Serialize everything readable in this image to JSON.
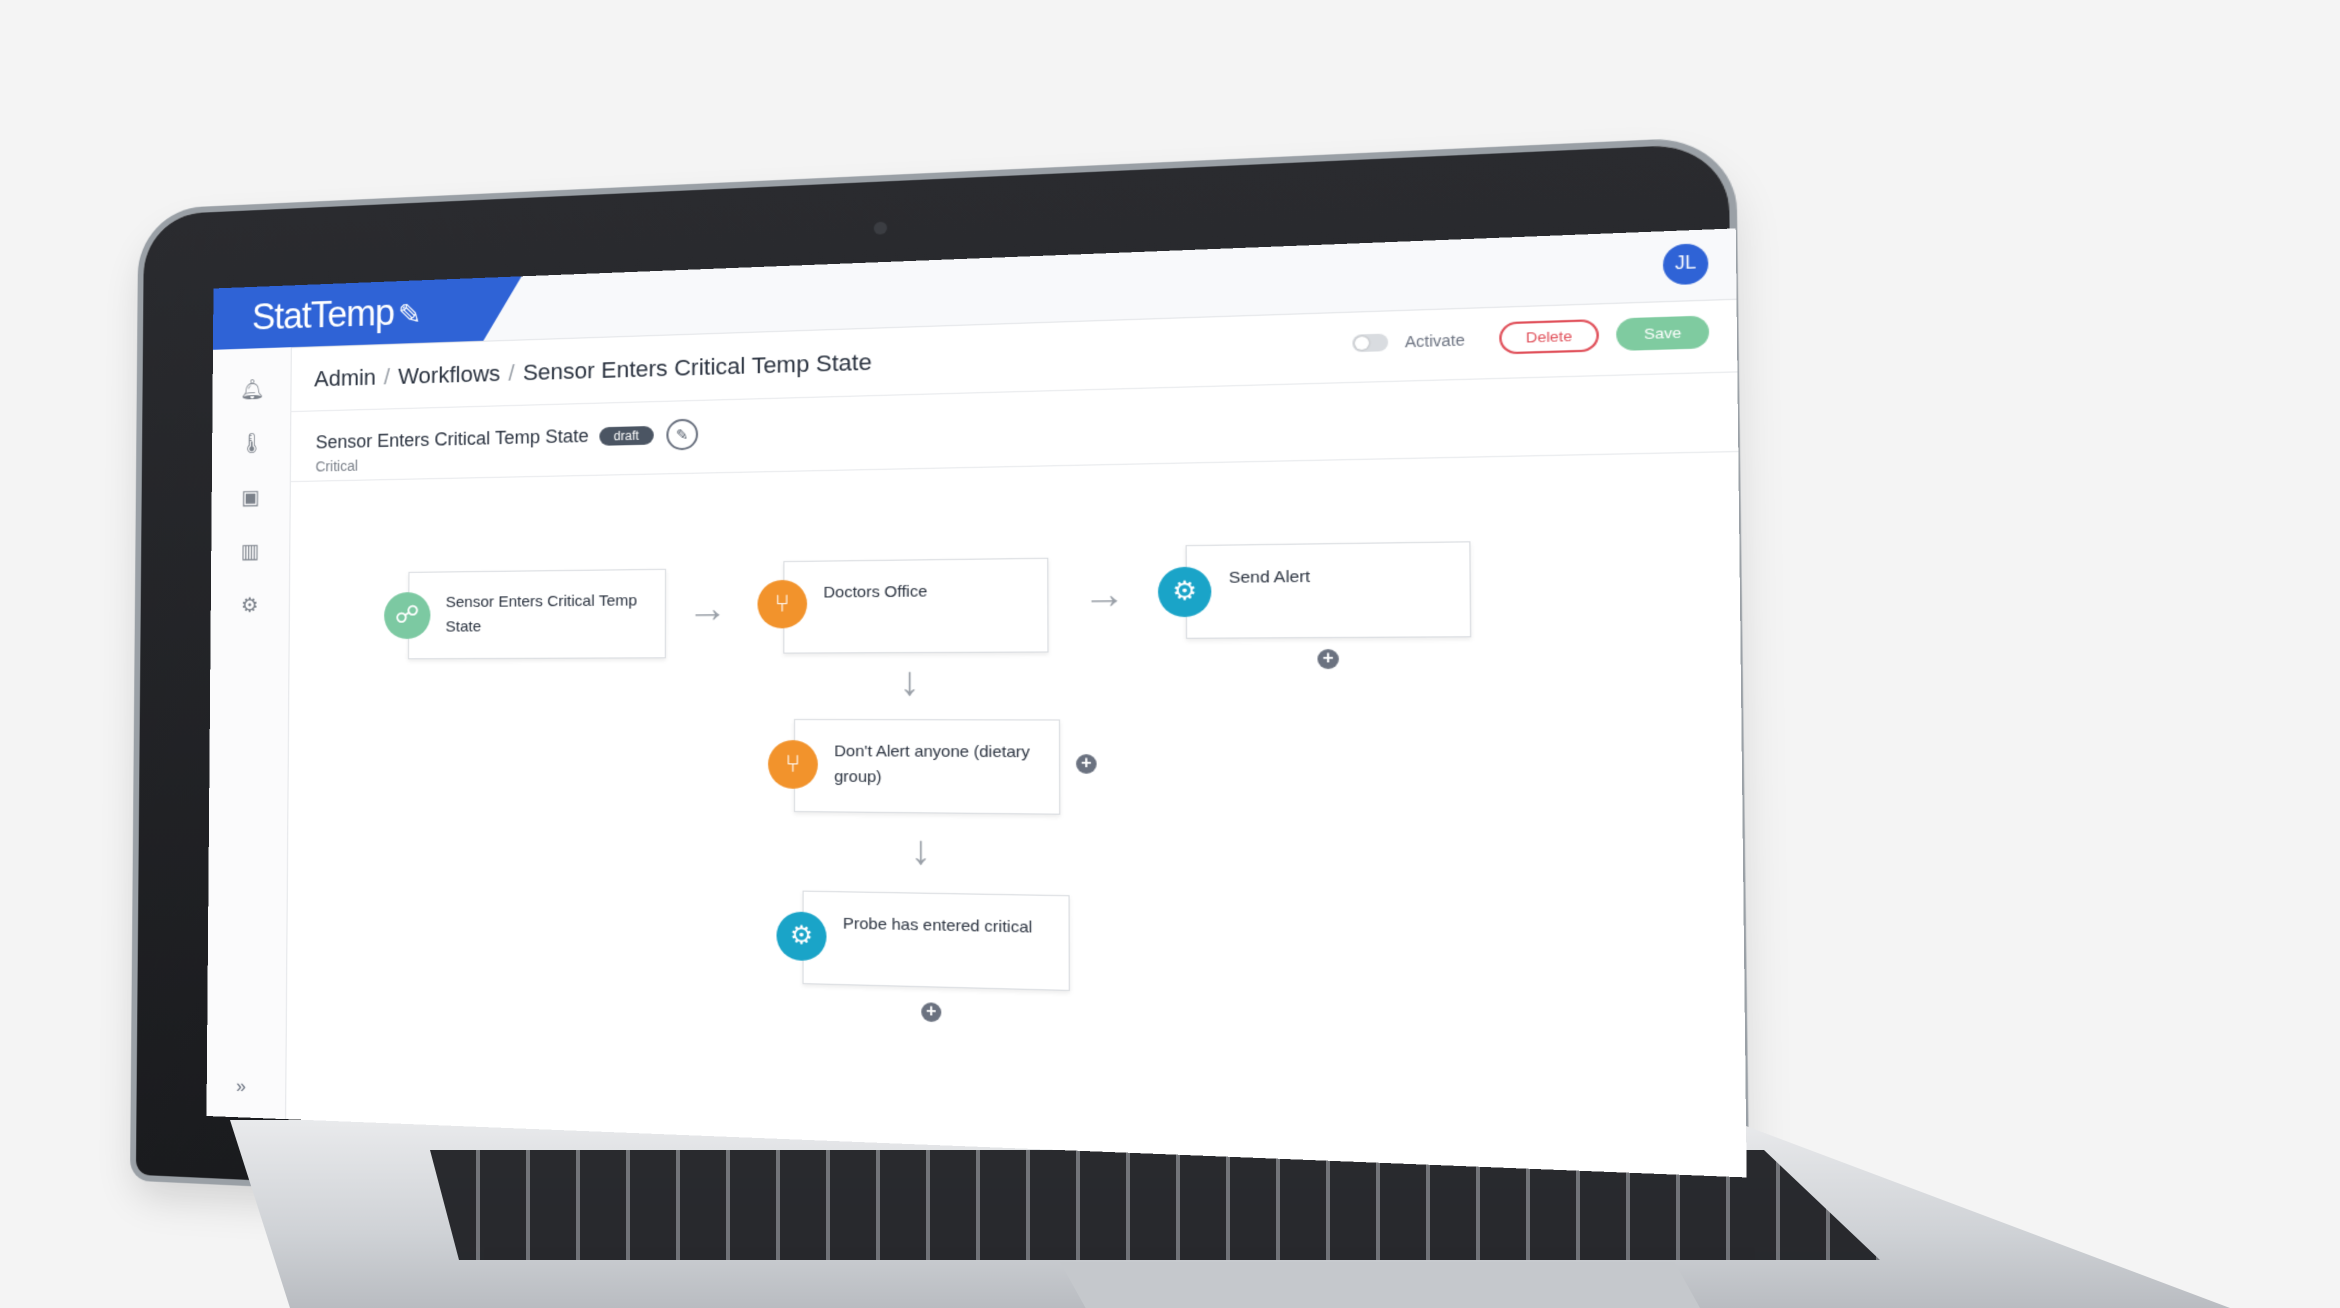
{
  "app": {
    "brand": "StatTemp",
    "avatar_initials": "JL"
  },
  "breadcrumb": {
    "items": [
      "Admin",
      "Workflows",
      "Sensor Enters Critical Temp State"
    ]
  },
  "actions": {
    "activate_label": "Activate",
    "delete_label": "Delete",
    "save_label": "Save"
  },
  "workflow": {
    "title": "Sensor Enters Critical Temp State",
    "status_badge": "draft",
    "subtitle": "Critical"
  },
  "nodes": {
    "trigger": "Sensor Enters Critical Temp State",
    "doctors_office": "Doctors Office",
    "send_alert": "Send Alert",
    "dont_alert": "Don't Alert anyone (dietary group)",
    "probe_critical": "Probe has entered critical"
  },
  "icons": {
    "sidebar": [
      "bell-icon",
      "thermometer-icon",
      "device-icon",
      "chart-icon",
      "settings-icon"
    ],
    "trigger": "network-icon",
    "branch": "branch-icon",
    "action": "gear-icon"
  },
  "colors": {
    "brand": "#2f63d6",
    "trigger": "#7cc9a2",
    "branch": "#f2932c",
    "action": "#1aa4c8",
    "delete": "#e0505a",
    "save": "#7fcba0"
  }
}
